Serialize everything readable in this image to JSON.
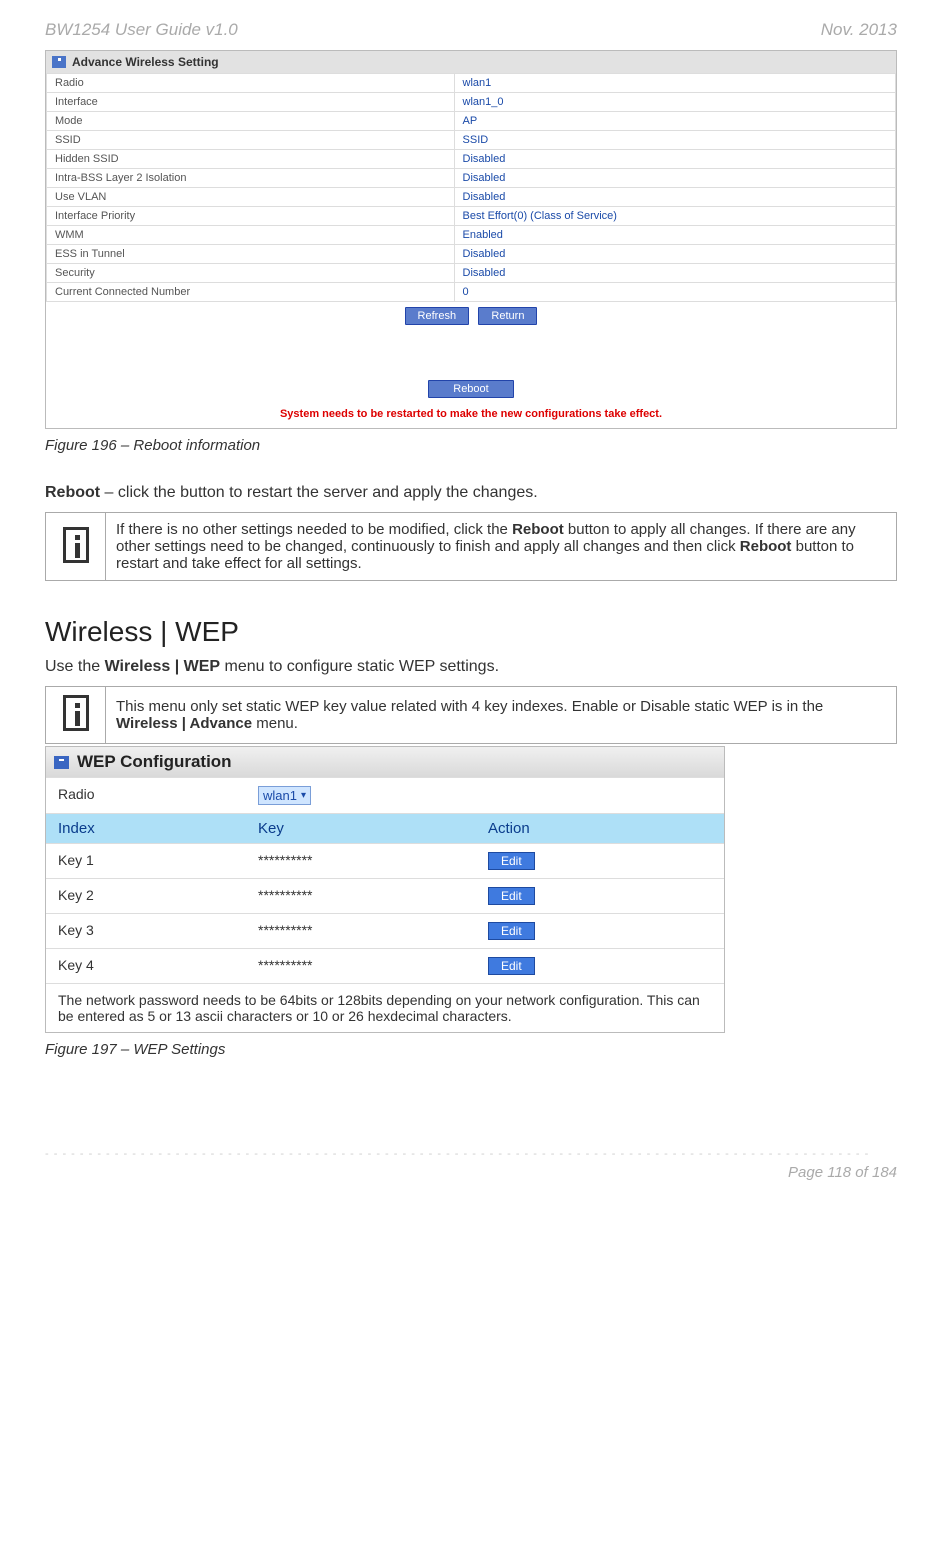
{
  "header": {
    "left": "BW1254 User Guide v1.0",
    "right": "Nov.  2013"
  },
  "adv": {
    "title": "Advance Wireless Setting",
    "rows": [
      {
        "label": "Radio",
        "value": "wlan1"
      },
      {
        "label": "Interface",
        "value": "wlan1_0"
      },
      {
        "label": "Mode",
        "value": "AP"
      },
      {
        "label": "SSID",
        "value": "SSID"
      },
      {
        "label": "Hidden SSID",
        "value": "Disabled"
      },
      {
        "label": "Intra-BSS Layer 2 Isolation",
        "value": "Disabled"
      },
      {
        "label": "Use VLAN",
        "value": "Disabled"
      },
      {
        "label": "Interface Priority",
        "value": "Best Effort(0)  (Class of Service)"
      },
      {
        "label": "WMM",
        "value": "Enabled"
      },
      {
        "label": "ESS in Tunnel",
        "value": "Disabled"
      },
      {
        "label": "Security",
        "value": " Disabled"
      },
      {
        "label": "Current Connected Number",
        "value": "0"
      }
    ],
    "refresh": "Refresh",
    "return": "Return",
    "reboot": "Reboot",
    "warn": "System needs to be restarted to make the new configurations take effect."
  },
  "fig196": "Figure 196 – Reboot information",
  "reboot_text_prefix": "Reboot",
  "reboot_text_rest": " – click the button to restart the server and apply the changes.",
  "info1_a": "If there is no other settings needed to be modified, click the ",
  "info1_b": "Reboot",
  "info1_c": " button to apply all changes. If there are any other settings need to be changed, continuously to finish and apply all changes and then click ",
  "info1_d": "Reboot",
  "info1_e": " button to restart and take effect  for all settings.",
  "section_title": "Wireless | WEP",
  "wep_intro_a": "Use the ",
  "wep_intro_b": "Wireless | WEP",
  "wep_intro_c": " menu to configure static WEP settings.",
  "info2_a": "This menu only set static WEP key value related with 4 key indexes. Enable or Disable static WEP is in the ",
  "info2_b": "Wireless | Advance",
  "info2_c": " menu.",
  "wep": {
    "title": "WEP Configuration",
    "radio_label": "Radio",
    "radio_value": "wlan1",
    "head_index": "Index",
    "head_key": "Key",
    "head_action": "Action",
    "keys": [
      {
        "idx": "Key 1",
        "val": "**********",
        "btn": "Edit"
      },
      {
        "idx": "Key 2",
        "val": "**********",
        "btn": "Edit"
      },
      {
        "idx": "Key 3",
        "val": "**********",
        "btn": "Edit"
      },
      {
        "idx": "Key 4",
        "val": "**********",
        "btn": "Edit"
      }
    ],
    "note": "    The network password needs to be 64bits or 128bits depending on your network configuration. This can be entered as 5 or 13 ascii characters or 10 or 26 hexdecimal characters."
  },
  "fig197": "Figure 197 – WEP Settings",
  "footer": "Page 118 of 184"
}
